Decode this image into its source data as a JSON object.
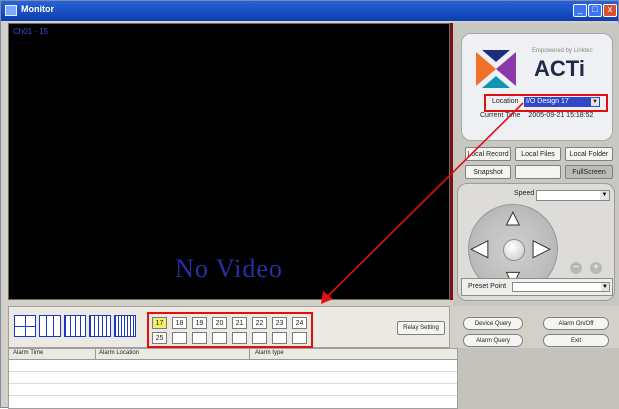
{
  "window": {
    "title": "Monitor",
    "colors": {
      "titlebar": "#0a3fb0",
      "video_bg": "#000000",
      "highlight": "#e01010"
    }
  },
  "video": {
    "channel_label": "Ch01 - 15",
    "status_text": "No Video"
  },
  "logo": {
    "tagline": "Empowered by Linktec",
    "brand": "ACTi"
  },
  "location": {
    "label": "Location",
    "value": "I/O Design 17"
  },
  "current_time": {
    "label": "Current Time",
    "value": "2005-09-21  15:18:52"
  },
  "buttons": {
    "local_record": "Local Record",
    "local_files": "Local Files",
    "local_folder": "Local Folder",
    "snapshot": "Snapshot",
    "blank": "",
    "full_screen": "FullScreen"
  },
  "ptz": {
    "speed_label": "Speed",
    "speed_value": "",
    "zoom_out": "−",
    "zoom_in": "+"
  },
  "preset": {
    "label": "Preset Point",
    "value": ""
  },
  "channels": {
    "row1": [
      "17",
      "18",
      "19",
      "20",
      "21",
      "22",
      "23",
      "24"
    ],
    "row2": [
      "25",
      "",
      "",
      "",
      "",
      "",
      "",
      ""
    ],
    "active": "17"
  },
  "relay_setting": "Relay Setting",
  "right_bottom": {
    "device_query": "Device Query",
    "alarm_onoff": "Alarm On/Off",
    "alarm_query": "Alarm Query",
    "exit": "Exit"
  },
  "alarm_table": {
    "columns": [
      "Alarm Time",
      "Alarm Location",
      "Alarm type"
    ]
  }
}
